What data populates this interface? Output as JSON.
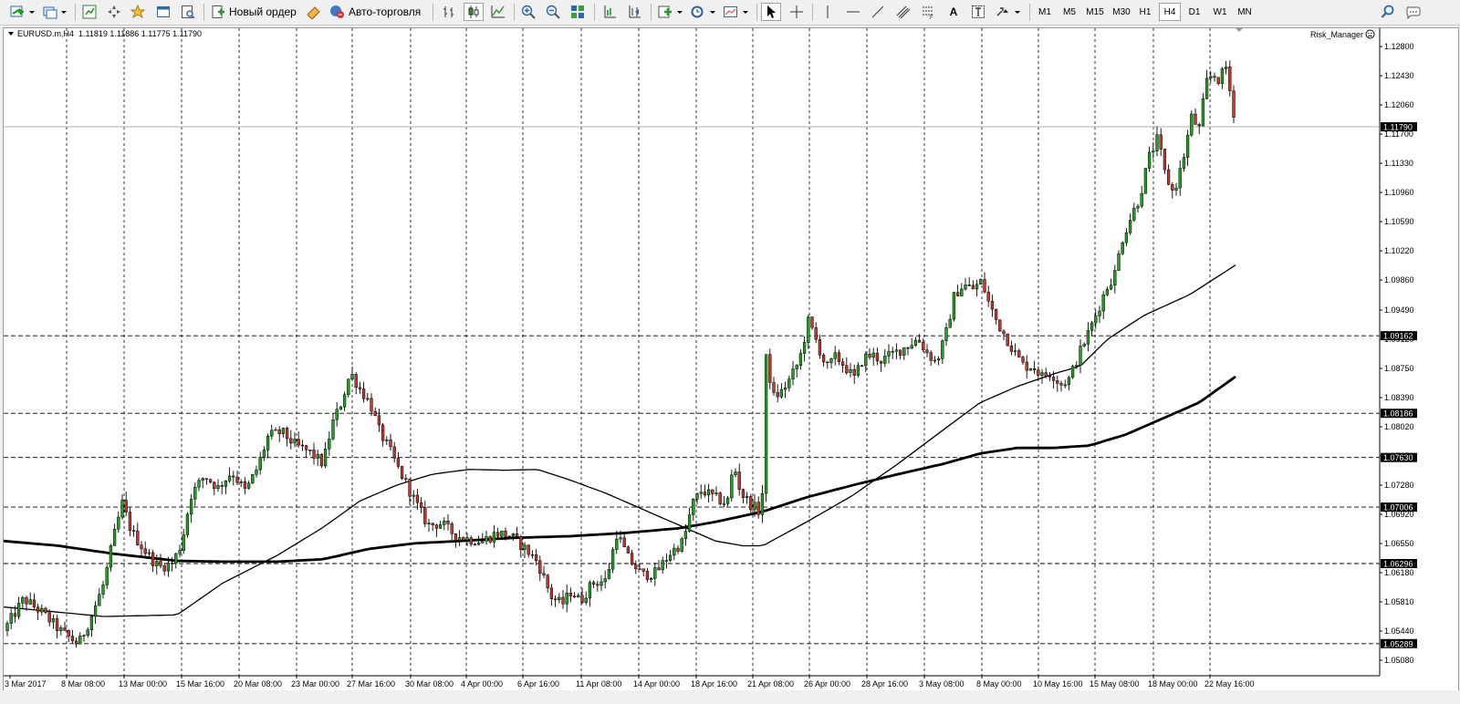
{
  "toolbar": {
    "new_order_label": "Новый ордер",
    "auto_trading_label": "Авто-торговля",
    "timeframes": [
      "M1",
      "M5",
      "M15",
      "M30",
      "H1",
      "H4",
      "D1",
      "W1",
      "MN"
    ],
    "active_timeframe": "H4"
  },
  "chart": {
    "header": "EURUSD.m,H4  1.11819 1.11886 1.11775 1.11790",
    "indicator": "Risk_Manager",
    "symbol": "EURUSD.m",
    "timeframe": "H4",
    "ohlc": {
      "open": 1.11819,
      "high": 1.11886,
      "low": 1.11775,
      "close": 1.1179
    }
  },
  "chart_data": {
    "type": "candlestick",
    "y_ticks": [
      "1.12800",
      "1.12430",
      "1.12060",
      "1.11700",
      "1.11330",
      "1.10960",
      "1.10590",
      "1.10220",
      "1.09860",
      "1.09490",
      "1.09120",
      "1.08750",
      "1.08390",
      "1.08020",
      "1.07650",
      "1.07280",
      "1.06920",
      "1.06550",
      "1.06180",
      "1.05810",
      "1.05440",
      "1.05080"
    ],
    "y_range": [
      1.0508,
      1.128
    ],
    "current_price": "1.11790",
    "level_lines": [
      "1.09162",
      "1.08186",
      "1.07630",
      "1.07006",
      "1.06296",
      "1.05289"
    ],
    "x_labels": [
      "3 Mar 2017",
      "8 Mar 08:00",
      "13 Mar 00:00",
      "15 Mar 16:00",
      "20 Mar 08:00",
      "23 Mar 00:00",
      "27 Mar 16:00",
      "30 Mar 08:00",
      "4 Apr 00:00",
      "6 Apr 16:00",
      "11 Apr 08:00",
      "14 Apr 00:00",
      "18 Apr 16:00",
      "21 Apr 08:00",
      "26 Apr 00:00",
      "28 Apr 16:00",
      "3 May 08:00",
      "8 May 00:00",
      "10 May 16:00",
      "15 May 08:00",
      "18 May 00:00",
      "22 May 16:00"
    ],
    "price_path": [
      [
        0,
        1.0545
      ],
      [
        22,
        1.0585
      ],
      [
        42,
        1.0568
      ],
      [
        62,
        1.0545
      ],
      [
        82,
        1.0528
      ],
      [
        95,
        1.056
      ],
      [
        110,
        1.0605
      ],
      [
        120,
        1.066
      ],
      [
        130,
        1.0705
      ],
      [
        140,
        1.067
      ],
      [
        155,
        1.0645
      ],
      [
        170,
        1.0625
      ],
      [
        185,
        1.063
      ],
      [
        195,
        1.0655
      ],
      [
        205,
        1.0715
      ],
      [
        220,
        1.074
      ],
      [
        235,
        1.0725
      ],
      [
        250,
        1.0745
      ],
      [
        265,
        1.072
      ],
      [
        278,
        1.075
      ],
      [
        290,
        1.079
      ],
      [
        305,
        1.0795
      ],
      [
        320,
        1.0778
      ],
      [
        335,
        1.077
      ],
      [
        350,
        1.0755
      ],
      [
        360,
        1.0805
      ],
      [
        370,
        1.0832
      ],
      [
        380,
        1.087
      ],
      [
        390,
        1.085
      ],
      [
        402,
        1.083
      ],
      [
        412,
        1.0795
      ],
      [
        422,
        1.0775
      ],
      [
        432,
        1.075
      ],
      [
        442,
        1.0728
      ],
      [
        452,
        1.0705
      ],
      [
        465,
        1.0678
      ],
      [
        480,
        1.068
      ],
      [
        495,
        1.0665
      ],
      [
        510,
        1.066
      ],
      [
        525,
        1.0658
      ],
      [
        540,
        1.0668
      ],
      [
        555,
        1.0665
      ],
      [
        570,
        1.065
      ],
      [
        585,
        1.0632
      ],
      [
        600,
        1.0588
      ],
      [
        612,
        1.0578
      ],
      [
        622,
        1.0595
      ],
      [
        632,
        1.0582
      ],
      [
        645,
        1.0605
      ],
      [
        660,
        1.0608
      ],
      [
        672,
        1.0668
      ],
      [
        685,
        1.0635
      ],
      [
        700,
        1.0615
      ],
      [
        715,
        1.0618
      ],
      [
        730,
        1.0642
      ],
      [
        745,
        1.0658
      ],
      [
        755,
        1.0705
      ],
      [
        765,
        1.0722
      ],
      [
        780,
        1.0712
      ],
      [
        793,
        1.0705
      ],
      [
        800,
        1.0755
      ],
      [
        808,
        1.0718
      ],
      [
        818,
        1.0705
      ],
      [
        828,
        1.0695
      ],
      [
        832,
        1.0722
      ],
      [
        836,
        1.0905
      ],
      [
        842,
        1.0838
      ],
      [
        852,
        1.0845
      ],
      [
        862,
        1.0862
      ],
      [
        872,
        1.0885
      ],
      [
        882,
        1.0935
      ],
      [
        892,
        1.0905
      ],
      [
        902,
        1.0875
      ],
      [
        912,
        1.089
      ],
      [
        922,
        1.0878
      ],
      [
        932,
        1.0862
      ],
      [
        942,
        1.0888
      ],
      [
        952,
        1.0892
      ],
      [
        962,
        1.0885
      ],
      [
        972,
        1.0892
      ],
      [
        982,
        1.0898
      ],
      [
        992,
        1.0905
      ],
      [
        1002,
        1.0912
      ],
      [
        1012,
        1.0895
      ],
      [
        1022,
        1.0882
      ],
      [
        1032,
        1.0915
      ],
      [
        1042,
        1.0968
      ],
      [
        1052,
        1.098
      ],
      [
        1062,
        1.0975
      ],
      [
        1072,
        1.0985
      ],
      [
        1078,
        1.0962
      ],
      [
        1088,
        1.0935
      ],
      [
        1098,
        1.0915
      ],
      [
        1108,
        1.0895
      ],
      [
        1118,
        1.0878
      ],
      [
        1128,
        1.0878
      ],
      [
        1138,
        1.0865
      ],
      [
        1148,
        1.087
      ],
      [
        1158,
        1.0855
      ],
      [
        1168,
        1.0862
      ],
      [
        1178,
        1.0892
      ],
      [
        1188,
        1.0918
      ],
      [
        1198,
        1.0945
      ],
      [
        1208,
        1.0975
      ],
      [
        1218,
        1.0995
      ],
      [
        1225,
        1.1035
      ],
      [
        1235,
        1.1065
      ],
      [
        1245,
        1.109
      ],
      [
        1255,
        1.114
      ],
      [
        1265,
        1.1165
      ],
      [
        1272,
        1.1122
      ],
      [
        1282,
        1.1095
      ],
      [
        1292,
        1.1135
      ],
      [
        1302,
        1.1192
      ],
      [
        1310,
        1.1175
      ],
      [
        1318,
        1.1235
      ],
      [
        1325,
        1.1245
      ],
      [
        1332,
        1.1238
      ],
      [
        1340,
        1.1255
      ],
      [
        1345,
        1.1215
      ],
      [
        1350,
        1.1185
      ],
      [
        1354,
        1.1179
      ]
    ],
    "series": [
      {
        "name": "MA (thin)",
        "path": [
          [
            0,
            1.0575
          ],
          [
            110,
            1.0563
          ],
          [
            190,
            1.0565
          ],
          [
            240,
            1.0605
          ],
          [
            300,
            1.064
          ],
          [
            350,
            1.0675
          ],
          [
            390,
            1.0708
          ],
          [
            430,
            1.0728
          ],
          [
            470,
            1.0742
          ],
          [
            510,
            1.0748
          ],
          [
            550,
            1.0747
          ],
          [
            585,
            1.0748
          ],
          [
            620,
            1.0735
          ],
          [
            660,
            1.0718
          ],
          [
            700,
            1.0698
          ],
          [
            740,
            1.0678
          ],
          [
            780,
            1.0658
          ],
          [
            810,
            1.0652
          ],
          [
            832,
            1.0652
          ],
          [
            880,
            1.0682
          ],
          [
            930,
            1.0715
          ],
          [
            980,
            1.0755
          ],
          [
            1030,
            1.0798
          ],
          [
            1070,
            1.0832
          ],
          [
            1110,
            1.0852
          ],
          [
            1150,
            1.0868
          ],
          [
            1180,
            1.0878
          ],
          [
            1210,
            1.0912
          ],
          [
            1250,
            1.0942
          ],
          [
            1300,
            1.0968
          ],
          [
            1354,
            1.1008
          ]
        ]
      },
      {
        "name": "MA (thick)",
        "path": [
          [
            0,
            1.0658
          ],
          [
            60,
            1.0652
          ],
          [
            120,
            1.0642
          ],
          [
            190,
            1.0633
          ],
          [
            240,
            1.0632
          ],
          [
            300,
            1.0632
          ],
          [
            350,
            1.0635
          ],
          [
            400,
            1.0648
          ],
          [
            450,
            1.0655
          ],
          [
            500,
            1.0658
          ],
          [
            560,
            1.0662
          ],
          [
            620,
            1.0664
          ],
          [
            680,
            1.0668
          ],
          [
            740,
            1.0674
          ],
          [
            780,
            1.0682
          ],
          [
            832,
            1.0695
          ],
          [
            880,
            1.0713
          ],
          [
            930,
            1.0728
          ],
          [
            980,
            1.0742
          ],
          [
            1030,
            1.0755
          ],
          [
            1070,
            1.0768
          ],
          [
            1110,
            1.0775
          ],
          [
            1150,
            1.0775
          ],
          [
            1190,
            1.0778
          ],
          [
            1230,
            1.0792
          ],
          [
            1270,
            1.0812
          ],
          [
            1310,
            1.0832
          ],
          [
            1354,
            1.0868
          ]
        ]
      }
    ],
    "grid": "dashed",
    "legend": "none"
  }
}
